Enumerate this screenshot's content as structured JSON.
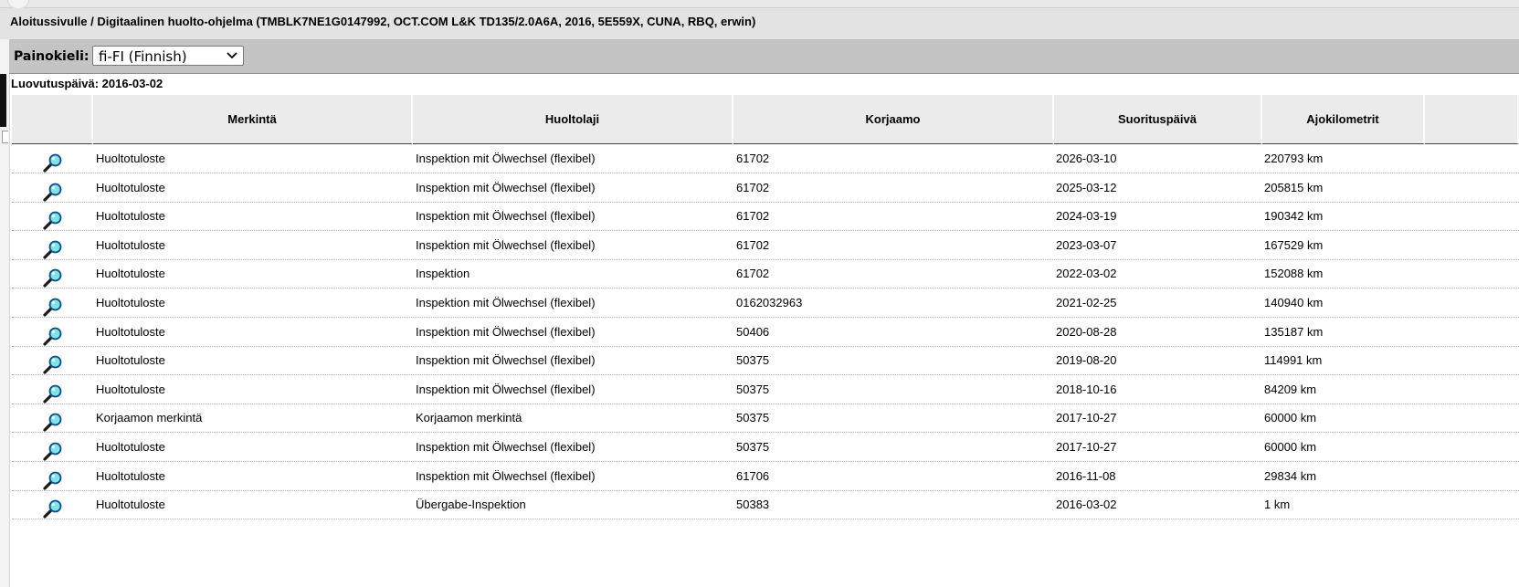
{
  "window": {
    "title": "Aloitussivulle / Digitaalinen huolto-ohjelma (TMBLK7NE1G0147992, OCT.COM L&K TD135/2.0A6A, 2016, 5E559X, CUNA, RBQ, erwin)"
  },
  "language": {
    "label": "Painokieli:",
    "selected": "fi-FI (Finnish)"
  },
  "delivery_date": "Luovutuspäivä: 2016-03-02",
  "table": {
    "headers": [
      "",
      "Merkintä",
      "Huoltolaji",
      "Korjaamo",
      "Suorituspäivä",
      "Ajokilometrit"
    ],
    "rows": [
      {
        "entry": "Huoltotuloste",
        "service": "Inspektion mit Ölwechsel (flexibel)",
        "workshop": "61702",
        "date": "2026-03-10",
        "km": "220793 km"
      },
      {
        "entry": "Huoltotuloste",
        "service": "Inspektion mit Ölwechsel (flexibel)",
        "workshop": "61702",
        "date": "2025-03-12",
        "km": "205815 km"
      },
      {
        "entry": "Huoltotuloste",
        "service": "Inspektion mit Ölwechsel (flexibel)",
        "workshop": "61702",
        "date": "2024-03-19",
        "km": "190342 km"
      },
      {
        "entry": "Huoltotuloste",
        "service": "Inspektion mit Ölwechsel (flexibel)",
        "workshop": "61702",
        "date": "2023-03-07",
        "km": "167529 km"
      },
      {
        "entry": "Huoltotuloste",
        "service": "Inspektion",
        "workshop": "61702",
        "date": "2022-03-02",
        "km": "152088 km"
      },
      {
        "entry": "Huoltotuloste",
        "service": "Inspektion mit Ölwechsel (flexibel)",
        "workshop": "0162032963",
        "date": "2021-02-25",
        "km": "140940 km"
      },
      {
        "entry": "Huoltotuloste",
        "service": "Inspektion mit Ölwechsel (flexibel)",
        "workshop": "50406",
        "date": "2020-08-28",
        "km": "135187 km"
      },
      {
        "entry": "Huoltotuloste",
        "service": "Inspektion mit Ölwechsel (flexibel)",
        "workshop": "50375",
        "date": "2019-08-20",
        "km": "114991 km"
      },
      {
        "entry": "Huoltotuloste",
        "service": "Inspektion mit Ölwechsel (flexibel)",
        "workshop": "50375",
        "date": "2018-10-16",
        "km": "84209 km"
      },
      {
        "entry": "Korjaamon merkintä",
        "service": "Korjaamon merkintä",
        "workshop": "50375",
        "date": "2017-10-27",
        "km": "60000 km"
      },
      {
        "entry": "Huoltotuloste",
        "service": "Inspektion mit Ölwechsel (flexibel)",
        "workshop": "50375",
        "date": "2017-10-27",
        "km": "60000 km"
      },
      {
        "entry": "Huoltotuloste",
        "service": "Inspektion mit Ölwechsel (flexibel)",
        "workshop": "61706",
        "date": "2016-11-08",
        "km": "29834 km"
      },
      {
        "entry": "Huoltotuloste",
        "service": "Übergabe-Inspektion",
        "workshop": "50383",
        "date": "2016-03-02",
        "km": "1 km"
      }
    ]
  },
  "icons": {
    "row_action": "magnifier-icon",
    "select_arrow": "chevron-down-icon"
  }
}
